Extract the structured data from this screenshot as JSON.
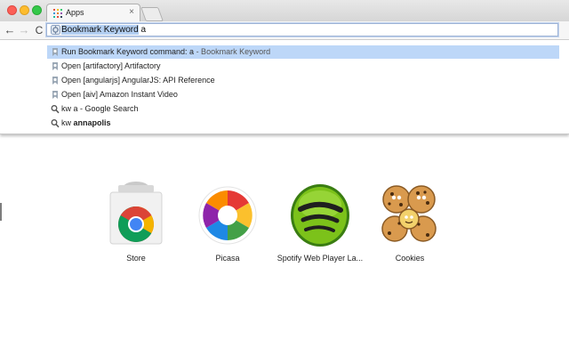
{
  "window": {
    "tab_title": "Apps",
    "tab_close": "×"
  },
  "toolbar": {
    "back_icon": "←",
    "forward_icon": "→",
    "reload_icon": "C",
    "omnibox": {
      "keyword_text": "Bookmark Keyword",
      "query_text": " a"
    }
  },
  "suggestions": [
    {
      "icon": "bookmark-keyword-icon",
      "main": "Run Bookmark Keyword command: a",
      "desc": " - Bookmark Keyword",
      "selected": true
    },
    {
      "icon": "bookmark-keyword-icon",
      "main": "Open [artifactory] Artifactory",
      "desc": "",
      "selected": false
    },
    {
      "icon": "bookmark-keyword-icon",
      "main": "Open [angularjs] AngularJS: API Reference",
      "desc": "",
      "selected": false
    },
    {
      "icon": "bookmark-keyword-icon",
      "main": "Open [aiv] Amazon Instant Video",
      "desc": "",
      "selected": false
    },
    {
      "icon": "search-icon",
      "main": "kw a - Google Search",
      "desc": "",
      "selected": false
    },
    {
      "icon": "search-icon",
      "prefix": "kw ",
      "emphasis": "annapolis",
      "selected": false
    }
  ],
  "apps": [
    {
      "label": "Store",
      "icon": "chrome-web-store-icon"
    },
    {
      "label": "Picasa",
      "icon": "picasa-icon"
    },
    {
      "label": "Spotify Web Player La...",
      "icon": "spotify-icon"
    },
    {
      "label": "Cookies",
      "icon": "cookies-icon"
    }
  ]
}
